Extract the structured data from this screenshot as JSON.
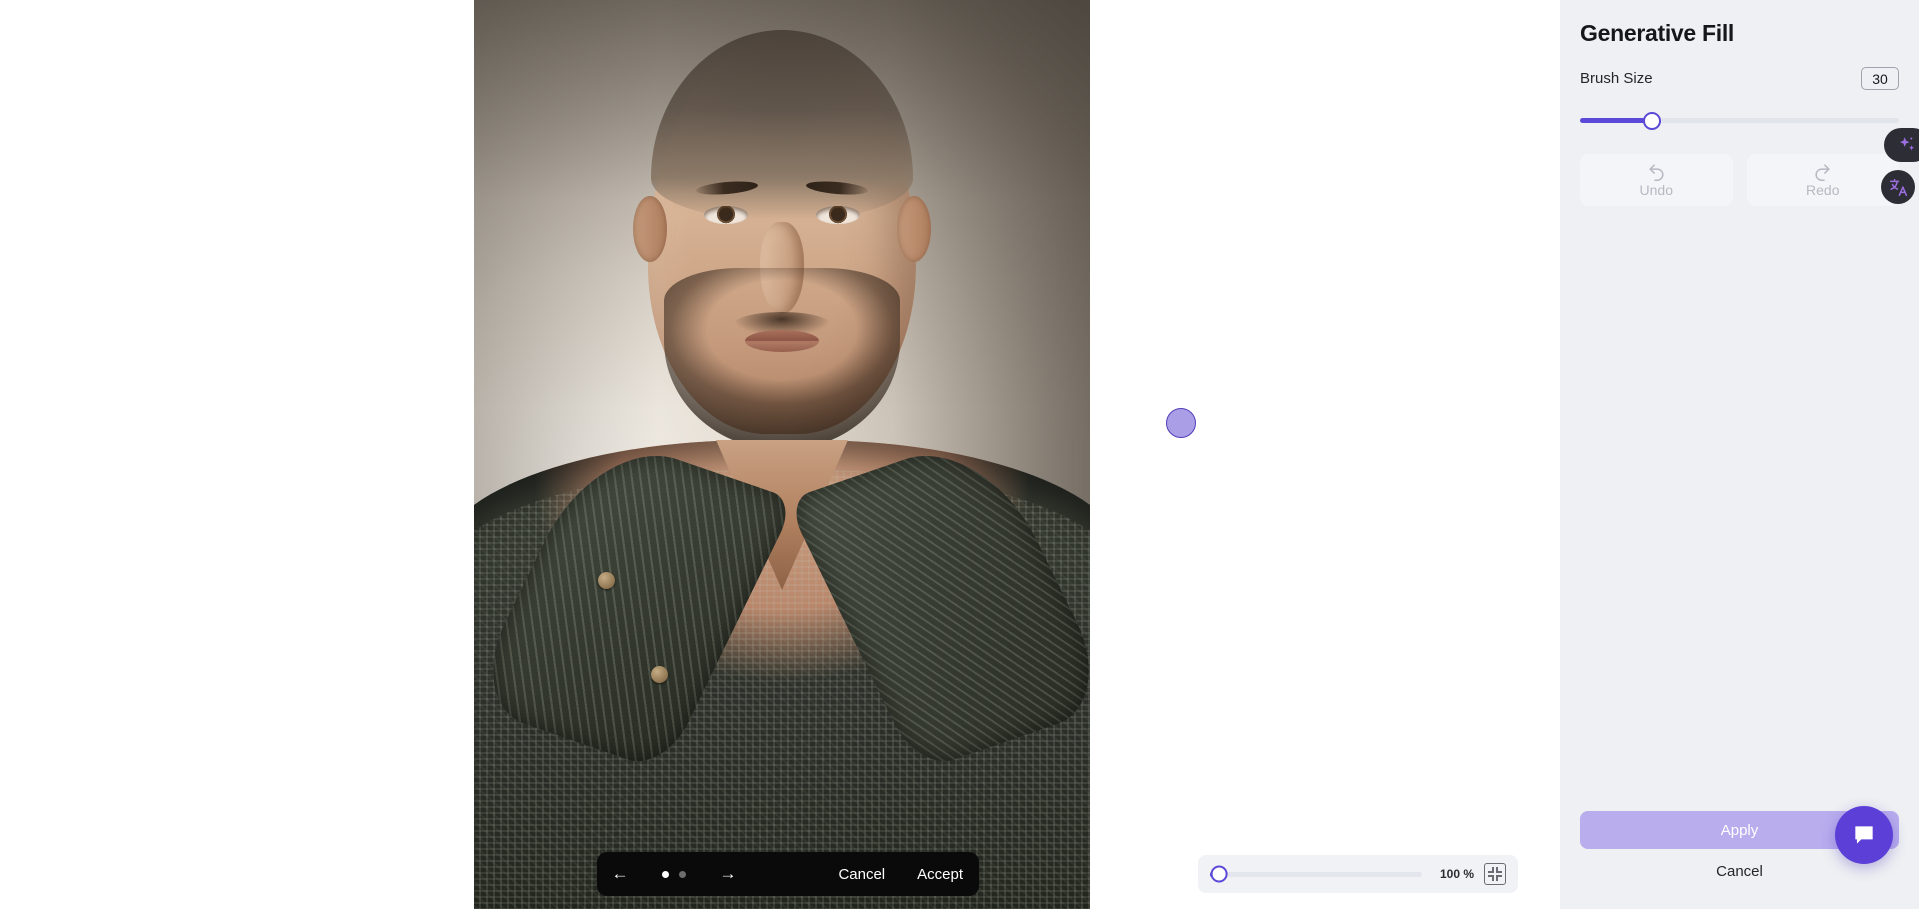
{
  "panel": {
    "title": "Generative Fill",
    "brush_size_label": "Brush Size",
    "brush_size_value": "30",
    "brush_size_percent": 22.5,
    "undo_label": "Undo",
    "redo_label": "Redo",
    "apply_label": "Apply",
    "cancel_label": "Cancel",
    "accent_color": "#5b4ad8",
    "apply_disabled_color": "#b9adee",
    "background_color": "#eef0f3"
  },
  "gen_toolbar": {
    "prev_label": "←",
    "next_label": "→",
    "cancel_label": "Cancel",
    "accept_label": "Accept",
    "variation_count": 2,
    "active_variation": 1,
    "background_color": "#0a0a0a"
  },
  "zoom_bar": {
    "value_label": "100 %",
    "slider_percent": 2,
    "fit_icon": "fit-to-screen-icon"
  },
  "canvas": {
    "brush_cursor": "brush-cursor",
    "background_color": "#ffffff",
    "image_alt": "portrait-photo-of-man-in-knit-sweater"
  },
  "overlay_buttons": {
    "ai_icon": "sparkle-ai-icon",
    "translate_icon": "translate-icon",
    "chat_icon": "chat-bubble-icon"
  }
}
